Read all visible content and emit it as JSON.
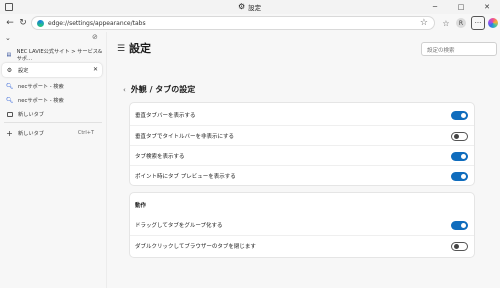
{
  "window": {
    "title": "設定",
    "minimize": "─",
    "maximize": "□",
    "close": "✕"
  },
  "toolbar": {
    "url": "edge://settings/appearance/tabs",
    "profile_initial": "R",
    "more": "···"
  },
  "sidebar": {
    "tabs": [
      {
        "icon": "nec-logo-icon",
        "title": "NEC LAVIE公式サイト > サービス&サポ…",
        "active": false
      },
      {
        "icon": "gear-icon",
        "title": "設定",
        "active": true
      },
      {
        "icon": "bing-search-icon",
        "title": "necサポート - 検索",
        "active": false
      },
      {
        "icon": "bing-search-icon",
        "title": "necサポート - 検索",
        "active": false
      },
      {
        "icon": "tab-page-icon",
        "title": "新しいタブ",
        "active": false
      }
    ],
    "new_tab_label": "新しいタブ",
    "new_tab_shortcut": "Ctrl+T"
  },
  "settings": {
    "page_title": "設定",
    "search_placeholder": "設定の検索",
    "section_title": "外観 / タブの設定",
    "tab_options": [
      {
        "label": "垂直タブバーを表示する",
        "on": true
      },
      {
        "label": "垂直タブでタイトルバーを非表示にする",
        "on": false
      },
      {
        "label": "タブ検索を表示する",
        "on": true
      },
      {
        "label": "ポイント時にタブ プレビューを表示する",
        "on": true
      }
    ],
    "behavior_heading": "動作",
    "behavior_options": [
      {
        "label": "ドラッグしてタブをグループ化する",
        "on": true
      },
      {
        "label": "ダブルクリックしてブラウザーのタブを閉じます",
        "on": false
      }
    ]
  },
  "colors": {
    "accent": "#0f6cbd",
    "background": "#f7f7f7",
    "card": "#ffffff"
  }
}
